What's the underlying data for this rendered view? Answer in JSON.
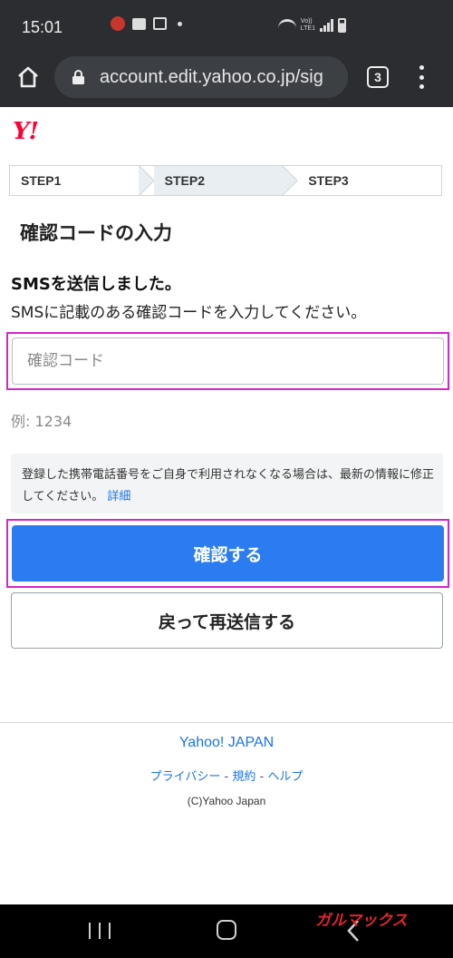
{
  "status_bar": {
    "time": "15:01",
    "volte_label_line1": "Vo))",
    "volte_label_line2": "LTE1"
  },
  "browser": {
    "url": "account.edit.yahoo.co.jp/sig",
    "tab_count": "3"
  },
  "logo_text": "Y!",
  "steps": [
    "STEP1",
    "STEP2",
    "STEP3"
  ],
  "active_step_index": 1,
  "section_title": "確認コードの入力",
  "message_heading": "SMSを送信しました。",
  "message_body": "SMSに記載のある確認コードを入力してください。",
  "code_input": {
    "placeholder": "確認コード",
    "value": ""
  },
  "example_text": "例: 1234",
  "notice": {
    "text": "登録した携帯電話番号をご自身で利用されなくなる場合は、最新の情報に修正してください。",
    "link": "詳細"
  },
  "confirm_button": "確認する",
  "back_button": "戻って再送信する",
  "footer": {
    "brand": "Yahoo! JAPAN",
    "links": [
      "プライバシー",
      "規約",
      "ヘルプ"
    ],
    "separator": " - ",
    "copyright": "(C)Yahoo Japan"
  },
  "watermark": "ガルマックス",
  "colors": {
    "primary_button": "#2a7cf0",
    "highlight_border": "#d326c9",
    "link": "#1a73e8",
    "logo_red": "#ff0033",
    "system_bar": "#2b2d31"
  },
  "icons": [
    "home-icon",
    "lock-icon",
    "tabs-icon",
    "more-vert-icon",
    "nav-recent-icon",
    "nav-home-icon",
    "nav-back-icon"
  ]
}
